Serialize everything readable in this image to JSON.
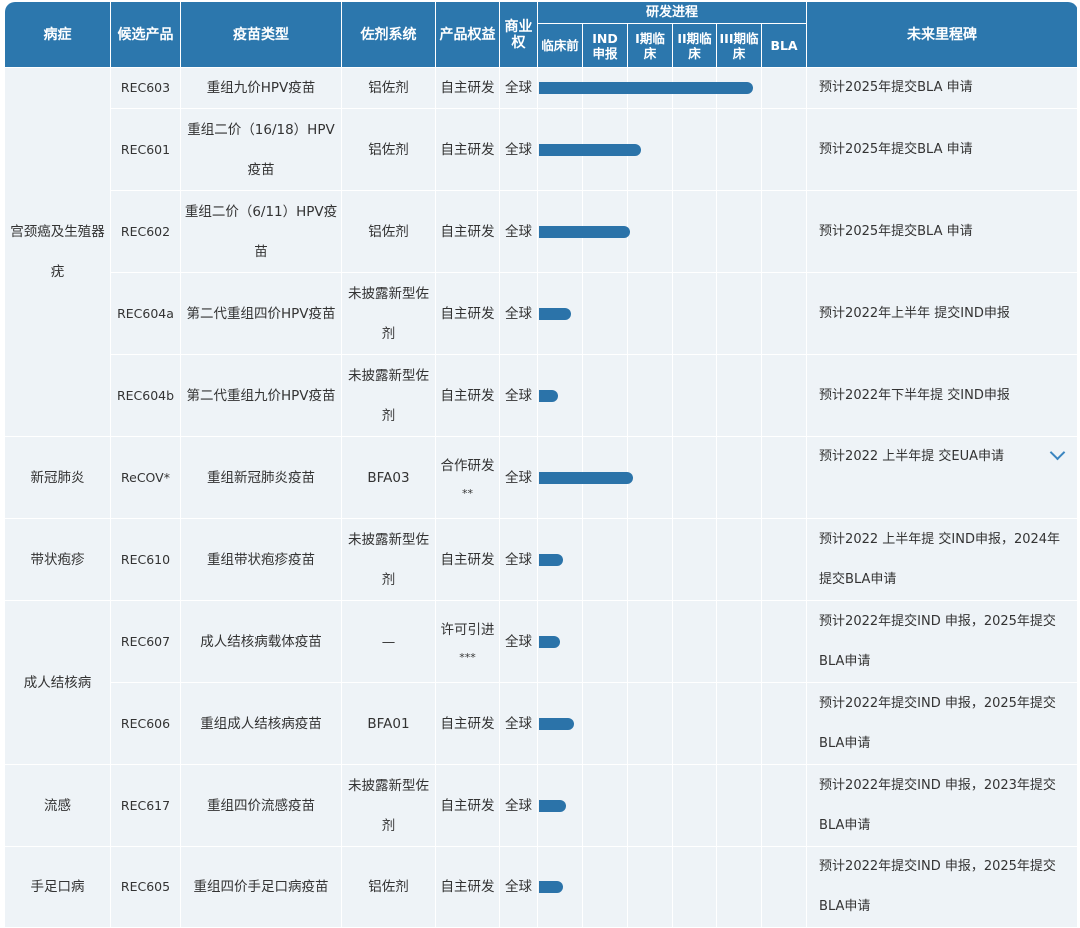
{
  "headers": {
    "indication": "病症",
    "candidate": "候选产品",
    "vaccine_type": "疫苗类型",
    "adjuvant": "佐剂系统",
    "rights": "产品权益",
    "commercial": "商业权",
    "progress": "研发进程",
    "milestone": "未来里程碑",
    "stages": [
      "临床前",
      "IND申报",
      "I期临床",
      "II期临床",
      "III期临床",
      "BLA"
    ]
  },
  "colors": {
    "header_bg": "#2c77ad",
    "row_bg": "#eef3f7",
    "bar": "#2b73a9"
  },
  "rows": [
    {
      "indication": "宫颈癌及生殖器疣",
      "candidate": "REC603",
      "vaccine_type": "重组九价HPV疫苗",
      "adjuvant": "铝佐剂",
      "rights": "自主研发",
      "commercial": "全球",
      "progress": 0.8,
      "milestone": "预计2025年提交BLA 申请"
    },
    {
      "indication": "",
      "candidate": "REC601",
      "vaccine_type": "重组二价（16/18）HPV疫苗",
      "adjuvant": "铝佐剂",
      "rights": "自主研发",
      "commercial": "全球",
      "progress": 0.38,
      "milestone": "预计2025年提交BLA 申请"
    },
    {
      "indication": "",
      "candidate": "REC602",
      "vaccine_type": "重组二价（6/11）HPV疫苗",
      "adjuvant": "铝佐剂",
      "rights": "自主研发",
      "commercial": "全球",
      "progress": 0.34,
      "milestone": "预计2025年提交BLA 申请"
    },
    {
      "indication": "",
      "candidate": "REC604a",
      "vaccine_type": "第二代重组四价HPV疫苗",
      "adjuvant": "未披露新型佐剂",
      "rights": "自主研发",
      "commercial": "全球",
      "progress": 0.12,
      "milestone": "预计2022年上半年 提交IND申报"
    },
    {
      "indication": "",
      "candidate": "REC604b",
      "vaccine_type": "第二代重组九价HPV疫苗",
      "adjuvant": "未披露新型佐剂",
      "rights": "自主研发",
      "commercial": "全球",
      "progress": 0.07,
      "milestone": "预计2022年下半年提 交IND申报"
    },
    {
      "indication": "新冠肺炎",
      "candidate": "ReCOV*",
      "vaccine_type": "重组新冠肺炎疫苗",
      "adjuvant": "BFA03",
      "rights": "合作研发",
      "rights_note": "**",
      "commercial": "全球",
      "progress": 0.35,
      "milestone": "预计2022 上半年提 交EUA申请"
    },
    {
      "indication": "带状疱疹",
      "candidate": "REC610",
      "vaccine_type": "重组带状疱疹疫苗",
      "adjuvant": "未披露新型佐剂",
      "rights": "自主研发",
      "commercial": "全球",
      "progress": 0.09,
      "milestone": "预计2022 上半年提 交IND申报，2024年 提交BLA申请"
    },
    {
      "indication": "成人结核病",
      "candidate": "REC607",
      "vaccine_type": "成人结核病载体疫苗",
      "adjuvant": "—",
      "rights": "许可引进",
      "rights_note": "***",
      "commercial": "全球",
      "progress": 0.08,
      "milestone": "预计2022年提交IND 申报，2025年提交 BLA申请"
    },
    {
      "indication": "",
      "candidate": "REC606",
      "vaccine_type": "重组成人结核病疫苗",
      "adjuvant": "BFA01",
      "rights": "自主研发",
      "commercial": "全球",
      "progress": 0.13,
      "milestone": "预计2022年提交IND 申报，2025年提交 BLA申请"
    },
    {
      "indication": "流感",
      "candidate": "REC617",
      "vaccine_type": "重组四价流感疫苗",
      "adjuvant": "未披露新型佐剂",
      "rights": "自主研发",
      "commercial": "全球",
      "progress": 0.1,
      "milestone": "预计2022年提交IND 申报，2023年提交 BLA申请"
    },
    {
      "indication": "手足口病",
      "candidate": "REC605",
      "vaccine_type": "重组四价手足口病疫苗",
      "adjuvant": "铝佐剂",
      "rights": "自主研发",
      "commercial": "全球",
      "progress": 0.09,
      "milestone": "预计2022年提交IND 申报，2025年提交 BLA申请"
    }
  ]
}
